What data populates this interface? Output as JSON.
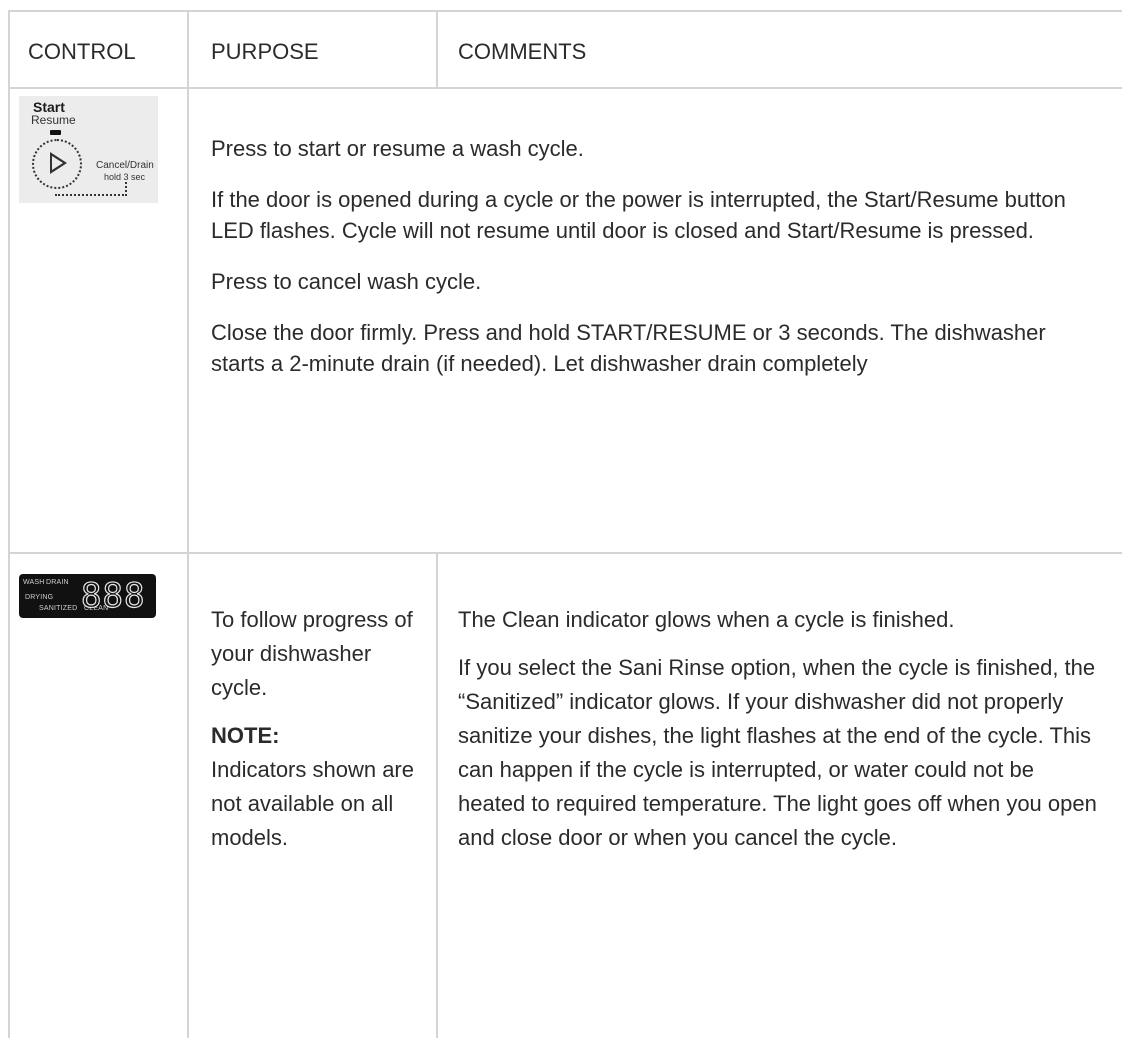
{
  "table": {
    "headers": {
      "control": "CONTROL",
      "purpose": "PURPOSE",
      "comments": "COMMENTS"
    },
    "rows": [
      {
        "control_image": {
          "icon": "start-resume-button-image",
          "start_label": "Start",
          "resume_label": "Resume",
          "cancel_label": "Cancel/Drain",
          "hold_label": "hold 3 sec"
        },
        "paragraphs": [
          "Press to start or resume a wash cycle.",
          "If the door is opened during a cycle or the power is interrupted, the Start/Resume button LED flashes. Cycle will not resume until door is closed and Start/Resume is pressed.",
          "Press to cancel wash cycle.",
          "Close the door firmly. Press and hold START/RESUME or 3 seconds. The dishwasher starts a 2-minute drain (if needed). Let dishwasher drain completely"
        ]
      },
      {
        "control_image": {
          "icon": "status-display-image",
          "wash_label": "WASH",
          "drain_label": "DRAIN",
          "drying_label": "DRYING",
          "sanitized_label": "SANITIZED",
          "clean_label": "CLEAN",
          "digits": "888"
        },
        "purpose": {
          "text": "To follow progress of your dishwasher cycle.",
          "note_label": "NOTE:",
          "note_text": "Indicators shown are not available on all models."
        },
        "comments": [
          "The Clean indicator glows when a cycle is finished.",
          "If you select the Sani Rinse option, when the cycle is finished, the “Sanitized” indicator glows. If your dishwasher did not properly sanitize your dishes, the light flashes at the end of the cycle. This can happen if the cycle is interrupted, or water could not be heated to required temperature. The light goes off when you open and close door or when you cancel the cycle."
        ]
      }
    ]
  }
}
